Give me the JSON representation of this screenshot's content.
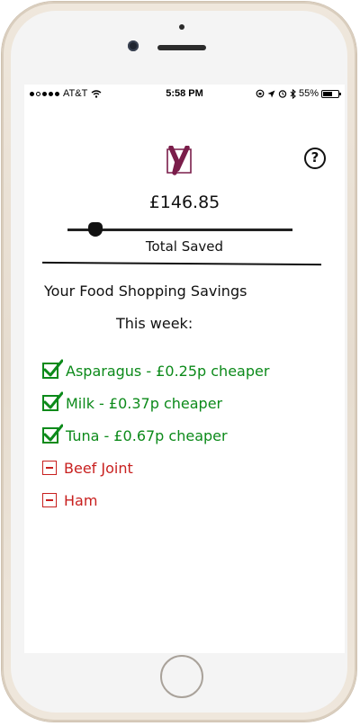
{
  "status_bar": {
    "carrier": "AT&T",
    "time": "5:58 PM",
    "battery": "55%"
  },
  "summary": {
    "amount": "£146.85",
    "savings_fraction": 0.1,
    "total_label": "Total Saved"
  },
  "content": {
    "heading": "Your Food Shopping Savings",
    "subheading": "This week:"
  },
  "items": [
    {
      "text": "Asparagus - £0.25p cheaper",
      "status": "saved"
    },
    {
      "text": "Milk - £0.37p cheaper",
      "status": "saved"
    },
    {
      "text": "Tuna  - £0.67p cheaper",
      "status": "saved"
    },
    {
      "text": "Beef Joint",
      "status": "not-saved"
    },
    {
      "text": "Ham",
      "status": "not-saved"
    }
  ],
  "colors": {
    "saved": "#0c8a1a",
    "not_saved": "#c8201f",
    "logo": "#7a1d4a"
  }
}
